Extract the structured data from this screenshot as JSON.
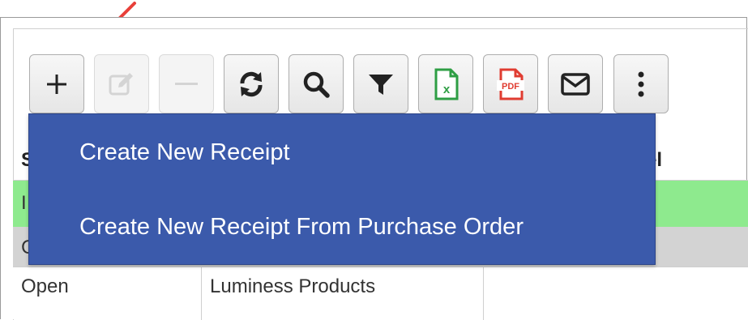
{
  "toolbar": {
    "buttons": [
      {
        "name": "add-button",
        "icon": "plus-icon",
        "enabled": true
      },
      {
        "name": "edit-button",
        "icon": "edit-icon",
        "enabled": false
      },
      {
        "name": "delete-button",
        "icon": "minus-icon",
        "enabled": false
      },
      {
        "name": "refresh-button",
        "icon": "refresh-icon",
        "enabled": true
      },
      {
        "name": "search-button",
        "icon": "search-icon",
        "enabled": true
      },
      {
        "name": "filter-button",
        "icon": "filter-icon",
        "enabled": true
      },
      {
        "name": "excel-export-button",
        "icon": "excel-file-icon",
        "enabled": true
      },
      {
        "name": "pdf-export-button",
        "icon": "pdf-file-icon",
        "enabled": true
      },
      {
        "name": "email-button",
        "icon": "envelope-icon",
        "enabled": true
      },
      {
        "name": "more-button",
        "icon": "more-vertical-icon",
        "enabled": true
      }
    ]
  },
  "dropdown": {
    "items": [
      {
        "label": "Create New Receipt"
      },
      {
        "label": "Create New Receipt From Purchase Order"
      }
    ]
  },
  "table": {
    "header_fragments": {
      "col1": "S",
      "col3": "el"
    },
    "rows": [
      {
        "status": "I",
        "vendor": "",
        "color": "#8eea8e"
      },
      {
        "status": "C",
        "vendor": "",
        "color": "#d3d3d3"
      },
      {
        "status": "Open",
        "vendor": "Luminess Products",
        "color": "#ffffff"
      }
    ]
  },
  "colors": {
    "menu_bg": "#3b5aab",
    "arrow": "#e8403a",
    "excel_green": "#2e9e44",
    "pdf_red": "#e03c31"
  }
}
